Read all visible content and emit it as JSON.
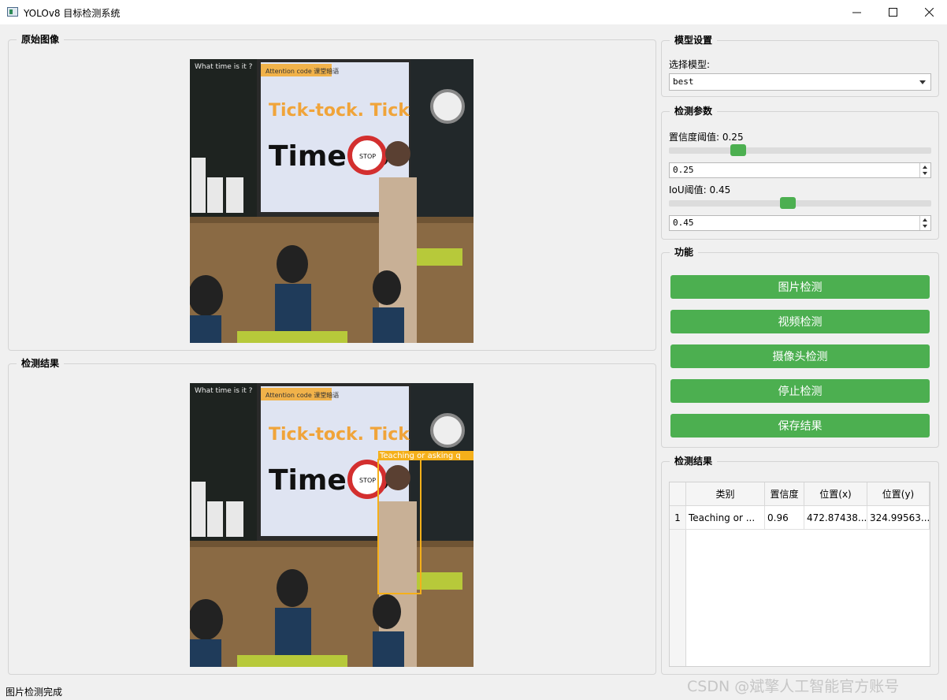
{
  "window": {
    "title": "YOLOv8 目标检测系统"
  },
  "original_panel": {
    "title": "原始图像",
    "scene": {
      "top_sign": "What time is it ?",
      "badge": "Attention code 课堂暗语",
      "headline": "Tick-tock. Tick-tock.",
      "caption": "Time to",
      "stop": "STOP"
    }
  },
  "result_panel": {
    "title": "检测结果",
    "scene": {
      "top_sign": "What time is it ?",
      "badge": "Attention code 课堂暗语",
      "headline": "Tick-tock. Tick-tock.",
      "caption": "Time to",
      "stop": "STOP"
    },
    "detection_label": "Teaching or asking q",
    "box_color": "#f5b01a"
  },
  "model_settings": {
    "title": "模型设置",
    "label": "选择模型:",
    "selected": "best"
  },
  "params": {
    "title": "检测参数",
    "conf_label": "置信度阈值: 0.25",
    "conf_value": "0.25",
    "iou_label": "IoU阈值: 0.45",
    "iou_value": "0.45"
  },
  "functions": {
    "title": "功能",
    "buttons": [
      "图片检测",
      "视频检测",
      "摄像头检测",
      "停止检测",
      "保存结果"
    ],
    "color": "#4caf50"
  },
  "results": {
    "title": "检测结果",
    "columns": [
      "类别",
      "置信度",
      "位置(x)",
      "位置(y)"
    ],
    "rows": [
      {
        "index": "1",
        "class": "Teaching or ...",
        "conf": "0.96",
        "x": "472.87438...",
        "y": "324.99563..."
      }
    ]
  },
  "status": "图片检测完成",
  "watermark": "CSDN @斌擎人工智能官方账号"
}
